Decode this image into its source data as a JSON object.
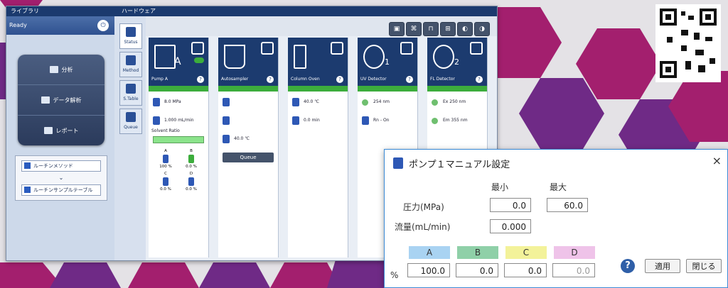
{
  "colors": {
    "magenta": "#a31f6e",
    "purple": "#6f2a86",
    "navy": "#1c3b6f",
    "green": "#3cad3c",
    "dialog_border": "#3a8ad6"
  },
  "left_panel": {
    "title": "ライブラリ",
    "status": "Ready",
    "nav": [
      {
        "label": "分析",
        "icon": "chart-icon"
      },
      {
        "label": "データ解析",
        "icon": "data-icon"
      },
      {
        "label": "レポート",
        "icon": "report-icon"
      }
    ],
    "sequence": [
      {
        "label": "ルーチンメソッド"
      },
      {
        "label": "ルーチンサンプルテーブル"
      }
    ]
  },
  "right_panel": {
    "title": "ハードウェア",
    "tabs": [
      {
        "label": "Status"
      },
      {
        "label": "Method"
      },
      {
        "label": "S.Table"
      },
      {
        "label": "Queue"
      }
    ],
    "modules": [
      {
        "name": "Pump A",
        "main_letter": "A",
        "rows": [
          "8.0 MPa",
          "1.000 mL/min"
        ]
      },
      {
        "name": "Autosampler",
        "rows": [
          "",
          "",
          "40.0 ℃"
        ],
        "queue": "Queue"
      },
      {
        "name": "Column Oven",
        "rows": [
          "40.0 ℃",
          "0.0 min"
        ]
      },
      {
        "name": "UV Detector",
        "badge": "1",
        "rows": [
          "254 nm",
          "Rn - On"
        ]
      },
      {
        "name": "FL Detector",
        "badge": "2",
        "rows": [
          "Ex 250 nm",
          "Em 355 nm"
        ]
      }
    ],
    "solvent_ratio": {
      "label": "Solvent Ratio",
      "items": [
        {
          "letter": "A",
          "value": "100 %"
        },
        {
          "letter": "B",
          "value": "0.0 %"
        },
        {
          "letter": "C",
          "value": "0.0 %"
        },
        {
          "letter": "D",
          "value": "0.0 %"
        }
      ]
    }
  },
  "dialog": {
    "title": "ポンプ１マニュアル設定",
    "close": "×",
    "min_label": "最小",
    "max_label": "最大",
    "pressure_label": "圧力(MPa)",
    "pressure_min": "0.0",
    "pressure_max": "60.0",
    "flow_label": "流量(mL/min)",
    "flow_value": "0.000",
    "percent": "%",
    "solvents": [
      {
        "letter": "A",
        "value": "100.0",
        "color": "#a9d3f2"
      },
      {
        "letter": "B",
        "value": "0.0",
        "color": "#8fd0a8"
      },
      {
        "letter": "C",
        "value": "0.0",
        "color": "#f3f29a"
      },
      {
        "letter": "D",
        "value": "0.0",
        "color": "#efc3e9"
      }
    ],
    "help": "?",
    "apply": "適用",
    "close_button": "閉じる"
  }
}
